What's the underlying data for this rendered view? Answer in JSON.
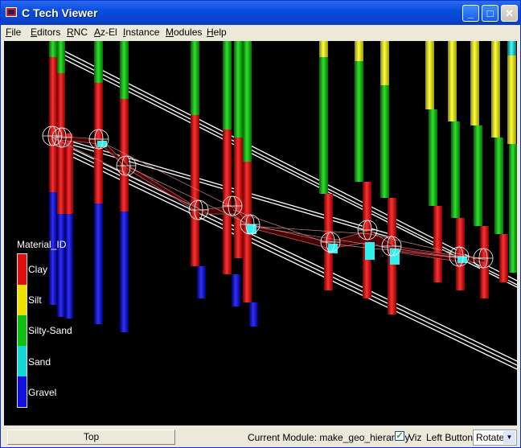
{
  "window": {
    "title": "C Tech Viewer",
    "minimize_label": "_",
    "maximize_label": "□",
    "close_label": "✕"
  },
  "menu": [
    "File",
    "Editors",
    "RNC",
    "Az-El",
    "Instance",
    "Modules",
    "Help"
  ],
  "legend": {
    "title": "Material_ID",
    "entries": [
      {
        "label": "Clay",
        "color": "#e01010"
      },
      {
        "label": "Silt",
        "color": "#f0e000"
      },
      {
        "label": "Silty-Sand",
        "color": "#10c010"
      },
      {
        "label": "Sand",
        "color": "#10d8d8"
      },
      {
        "label": "Gravel",
        "color": "#1010e0"
      }
    ]
  },
  "status": {
    "view_button": "Top",
    "current_module_label": "Current Module: make_geo_hierarchy",
    "viz_label": "Viz",
    "viz_checked": true,
    "left_button_label": "Left Button",
    "left_button_mode": "Rotate"
  }
}
